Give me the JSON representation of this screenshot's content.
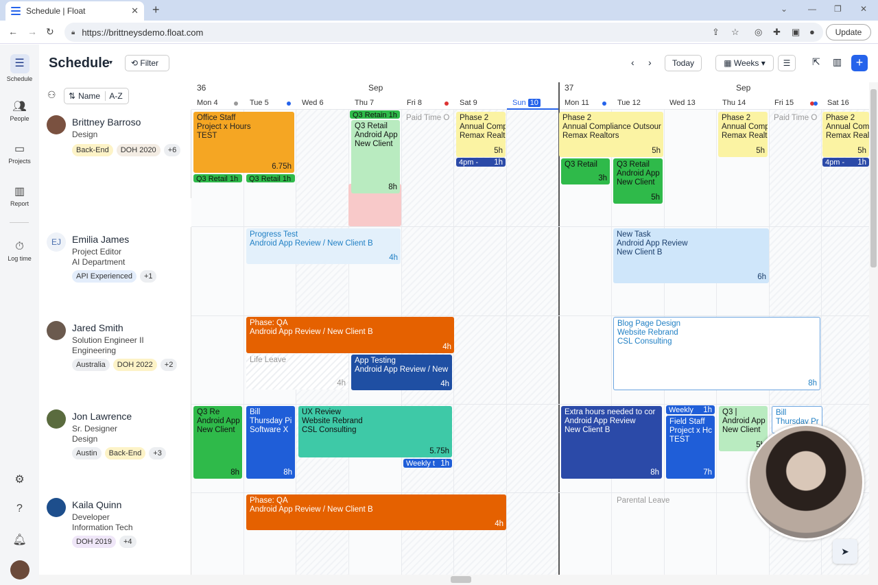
{
  "browser": {
    "tab_title": "Schedule | Float",
    "url": "https://brittneysdemo.float.com",
    "update_label": "Update"
  },
  "nav": {
    "items": [
      {
        "label": "Schedule",
        "icon": "schedule-icon"
      },
      {
        "label": "People",
        "icon": "people-icon"
      },
      {
        "label": "Projects",
        "icon": "folder-icon"
      },
      {
        "label": "Report",
        "icon": "chart-icon"
      },
      {
        "label": "Log time",
        "icon": "stopwatch-icon"
      }
    ]
  },
  "header": {
    "title": "Schedule",
    "filter_label": "Filter",
    "today_label": "Today",
    "view_label": "Weeks"
  },
  "sort": {
    "name_label": "Name",
    "order_label": "A-Z"
  },
  "calendar": {
    "weeks": [
      {
        "num": "36",
        "month": "Sep"
      },
      {
        "num": "37",
        "month": "Sep"
      }
    ],
    "days": [
      "Mon 4",
      "Tue 5",
      "Wed 6",
      "Thu 7",
      "Fri 8",
      "Sat 9",
      "Sun",
      "Mon 11",
      "Tue 12",
      "Wed 13",
      "Thu 14",
      "Fri 15",
      "Sat 16"
    ],
    "today_num": "10"
  },
  "people": [
    {
      "name": "Brittney Barroso",
      "role": "Design",
      "dept": "",
      "tags": [
        "Back-End",
        "DOH 2020",
        "+6"
      ]
    },
    {
      "name": "Emilia James",
      "initials": "EJ",
      "role": "Project Editor",
      "dept": "AI Department",
      "tags": [
        "API Experienced",
        "+1"
      ]
    },
    {
      "name": "Jared Smith",
      "role": "Solution Engineer II",
      "dept": "Engineering",
      "tags": [
        "Australia",
        "DOH 2022",
        "+2"
      ]
    },
    {
      "name": "Jon Lawrence",
      "role": "Sr. Designer",
      "dept": "Design",
      "tags": [
        "Austin",
        "Back-End",
        "+3"
      ]
    },
    {
      "name": "Kaila Quinn",
      "role": "Developer",
      "dept": "Information Tech",
      "tags": [
        "DOH 2019",
        "+4"
      ]
    }
  ],
  "events": {
    "e1": {
      "l1": "Office Staff",
      "l2": "Project x Hours",
      "l3": "TEST",
      "h": "6.75h"
    },
    "e2": {
      "l1": "Q3 Retail 1h"
    },
    "e3": {
      "l1": "Q3 Retail 1h"
    },
    "e4": {
      "l1": "Q3 Retain 1h"
    },
    "e5": {
      "l1": "Q3 Retail",
      "l2": "Android App",
      "l3": "New Client",
      "h": "8h"
    },
    "e6": {
      "l1": "Paid Time O"
    },
    "e7": {
      "l1": "Phase 2",
      "l2": "Annual Comp",
      "l3": "Remax Realt",
      "h": "5h"
    },
    "e8": {
      "l1": "4pm -",
      "h": "1h"
    },
    "e9": {
      "l1": "Phase 2",
      "l2": "Annual Compliance Outsour",
      "l3": "Remax Realtors",
      "h": "5h"
    },
    "e10": {
      "l1": "Q3 Retail",
      "h": "3h"
    },
    "e11": {
      "l1": "Q3 Retail",
      "l2": "Android App",
      "l3": "New Client",
      "h": "5h"
    },
    "e12": {
      "l1": "Phase 2",
      "l2": "Annual Comp",
      "l3": "Remax Realto",
      "h": "5h"
    },
    "e13": {
      "l1": "Paid Time O"
    },
    "e14": {
      "l1": "Phase 2",
      "l2": "Annual Comp",
      "l3": "Remax Realt",
      "h": "5h"
    },
    "e15": {
      "l1": "4pm -",
      "h": "1h"
    },
    "e16": {
      "l1": "Progress Test",
      "l2": "Android App Review / New Client B",
      "h": "4h"
    },
    "e17": {
      "l1": "New Task",
      "l2": "Android App Review",
      "l3": "New Client B",
      "h": "6h"
    },
    "e18": {
      "l1": "Phase: QA",
      "l2": "Android App Review / New Client B",
      "h": "4h"
    },
    "e19": {
      "l1": "Life Leave",
      "h": "4h"
    },
    "e20": {
      "l1": "App Testing",
      "l2": "Android App Review / New",
      "h": "4h"
    },
    "e21": {
      "l1": "Blog Page Design",
      "l2": "Website Rebrand",
      "l3": "CSL Consulting",
      "h": "8h"
    },
    "e22": {
      "l1": "Q3 Re",
      "l2": "Android App",
      "l3": "New Client",
      "h": "8h"
    },
    "e23": {
      "l1": "Bill",
      "l2": "Thursday Pi",
      "l3": "Software X",
      "h": "8h"
    },
    "e24": {
      "l1": "UX Review",
      "l2": "Website Rebrand",
      "l3": "CSL Consulting",
      "h": "5.75h"
    },
    "e25": {
      "l1": "Weekly t",
      "h": "1h"
    },
    "e26": {
      "l1": "Extra hours needed to cor",
      "l2": "Android App Review",
      "l3": "New Client B",
      "h": "8h"
    },
    "e27": {
      "l1": "Weekly",
      "h": "1h"
    },
    "e28": {
      "l1": "Field Staff",
      "l2": "Project x Hc",
      "l3": "TEST",
      "h": "7h"
    },
    "e29": {
      "l1": "Q3 |",
      "l2": "Android App",
      "l3": "New Client",
      "h": "5h"
    },
    "e30": {
      "l1": "Bill",
      "l2": "Thursday Pr",
      "l3": "So"
    },
    "e31": {
      "l1": "Phase: QA",
      "l2": "Android App Review / New Client B",
      "h": "4h"
    },
    "e32": {
      "l1": "Parental Leave"
    }
  },
  "colors": {
    "accent": "#2563eb",
    "orange": "#f5a623",
    "deep_orange": "#e56100",
    "green": "#2fba4a",
    "navy": "#2b4aa8"
  }
}
